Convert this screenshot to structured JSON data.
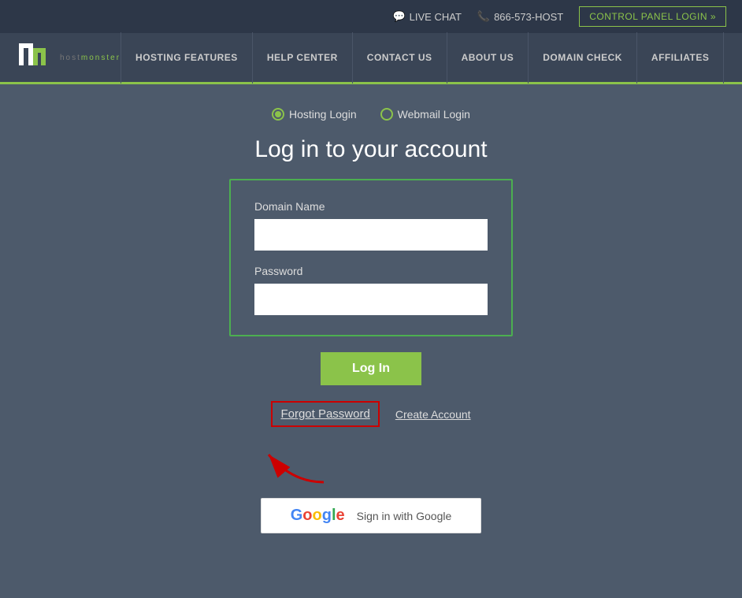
{
  "topbar": {
    "live_chat": "LIVE CHAT",
    "phone": "866-573-HOST",
    "control_panel_btn": "CONTROL PANEL LOGIN »"
  },
  "header": {
    "logo_text": "hostmonster",
    "nav_items": [
      {
        "label": "HOSTING FEATURES"
      },
      {
        "label": "HELP CENTER"
      },
      {
        "label": "CONTACT US"
      },
      {
        "label": "ABOUT US"
      },
      {
        "label": "DOMAIN CHECK"
      },
      {
        "label": "AFFILIATES"
      }
    ]
  },
  "login": {
    "hosting_login_label": "Hosting Login",
    "webmail_login_label": "Webmail Login",
    "title": "Log in to your account",
    "domain_label": "Domain Name",
    "domain_placeholder": "",
    "password_label": "Password",
    "password_placeholder": "",
    "login_btn": "Log In",
    "forgot_password": "Forgot Password",
    "create_account": "Create Account",
    "google_signin": "Sign in with Google"
  },
  "colors": {
    "green": "#8bc34a",
    "dark_bg": "#4d5a6b",
    "header_bg": "#3a4556",
    "topbar_bg": "#2d3748"
  }
}
